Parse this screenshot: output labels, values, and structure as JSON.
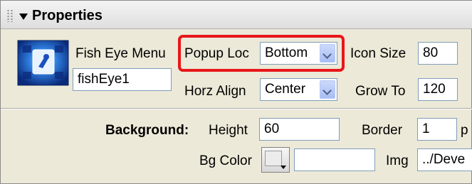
{
  "panel": {
    "title": "Properties"
  },
  "component": {
    "type_label": "Fish Eye Menu",
    "instance_name": "fishEye1"
  },
  "popup_loc": {
    "label": "Popup Loc",
    "value": "Bottom"
  },
  "horz_align": {
    "label": "Horz Align",
    "value": "Center"
  },
  "icon_size": {
    "label": "Icon Size",
    "value": "80"
  },
  "grow_to": {
    "label": "Grow To",
    "value": "120"
  },
  "background": {
    "section_label": "Background:",
    "height_label": "Height",
    "height_value": "60",
    "border_label": "Border",
    "border_value": "1",
    "border_unit": "p",
    "bgcolor_label": "Bg Color",
    "bgcolor_value": "",
    "img_label": "Img",
    "img_value": "../Deve"
  },
  "colors": {
    "highlight": "#e8161a",
    "panel_bg": "#ece9d8",
    "field_border": "#7f9db9"
  }
}
